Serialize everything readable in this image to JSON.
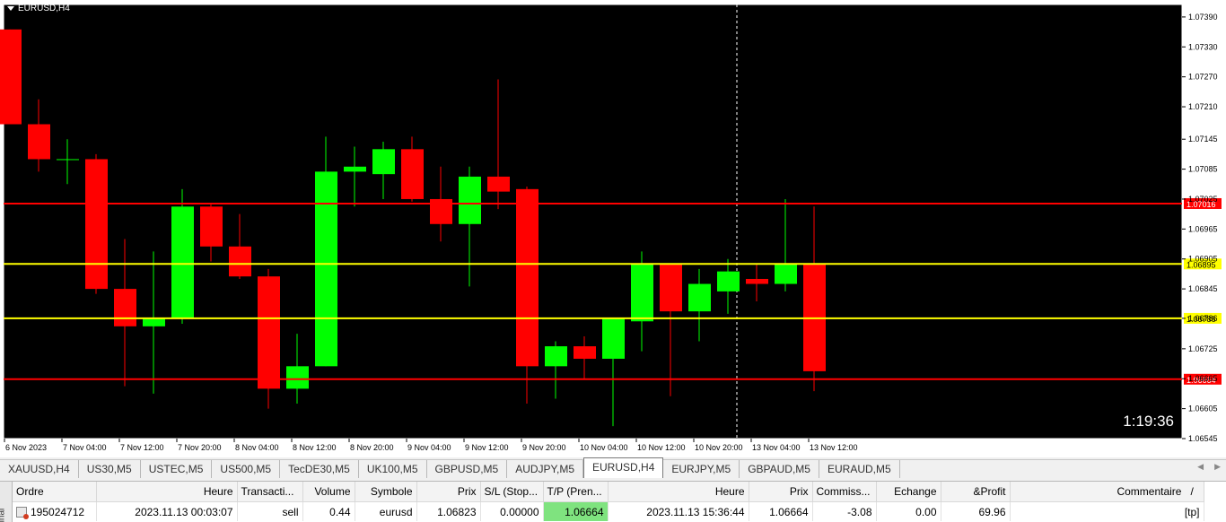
{
  "chart": {
    "title": "EURUSD,H4",
    "countdown": "1:19:36",
    "background": "#000000",
    "bull_color": "#00ff00",
    "bear_color": "#ff0000",
    "price_axis": [
      "1.07390",
      "1.07330",
      "1.07270",
      "1.07210",
      "1.07145",
      "1.07085",
      "1.07025",
      "1.06965",
      "1.06905",
      "1.06845",
      "1.06786",
      "1.06725",
      "1.06665",
      "1.06605",
      "1.06545"
    ],
    "price_min": 1.06545,
    "price_max": 1.07415,
    "time_axis": [
      "6 Nov 2023",
      "7 Nov 04:00",
      "7 Nov 12:00",
      "7 Nov 20:00",
      "8 Nov 04:00",
      "8 Nov 12:00",
      "8 Nov 20:00",
      "9 Nov 04:00",
      "9 Nov 12:00",
      "9 Nov 20:00",
      "10 Nov 04:00",
      "10 Nov 12:00",
      "10 Nov 20:00",
      "13 Nov 04:00",
      "13 Nov 12:00"
    ],
    "hlines": [
      {
        "price": 1.07016,
        "label": "1.07016",
        "color": "#ff0000",
        "text_color": "#ffffff"
      },
      {
        "price": 1.06895,
        "label": "1.06895",
        "color": "#ffff00",
        "text_color": "#000000"
      },
      {
        "price": 1.06786,
        "label": "1.06786",
        "color": "#ffff00",
        "text_color": "#000000"
      },
      {
        "price": 1.06664,
        "label": "1.06664",
        "color": "#ff0000",
        "text_color": "#ffffff"
      }
    ],
    "crosshair_x_index": 25,
    "candles": [
      {
        "o": 1.07365,
        "h": 1.07365,
        "l": 1.07175,
        "c": 1.07175
      },
      {
        "o": 1.07175,
        "h": 1.07225,
        "l": 1.0708,
        "c": 1.07105
      },
      {
        "o": 1.07105,
        "h": 1.07145,
        "l": 1.07055,
        "c": 1.07105
      },
      {
        "o": 1.07105,
        "h": 1.07115,
        "l": 1.06835,
        "c": 1.06845
      },
      {
        "o": 1.06845,
        "h": 1.06945,
        "l": 1.0665,
        "c": 1.0677
      },
      {
        "o": 1.0677,
        "h": 1.0692,
        "l": 1.06635,
        "c": 1.06785
      },
      {
        "o": 1.06785,
        "h": 1.07045,
        "l": 1.06775,
        "c": 1.0701
      },
      {
        "o": 1.0701,
        "h": 1.07015,
        "l": 1.069,
        "c": 1.0693
      },
      {
        "o": 1.0693,
        "h": 1.06995,
        "l": 1.06865,
        "c": 1.0687
      },
      {
        "o": 1.0687,
        "h": 1.06885,
        "l": 1.06605,
        "c": 1.06645
      },
      {
        "o": 1.06645,
        "h": 1.06755,
        "l": 1.06615,
        "c": 1.0669
      },
      {
        "o": 1.0669,
        "h": 1.0715,
        "l": 1.0669,
        "c": 1.0708
      },
      {
        "o": 1.0708,
        "h": 1.0713,
        "l": 1.0701,
        "c": 1.0709
      },
      {
        "o": 1.07075,
        "h": 1.0714,
        "l": 1.07025,
        "c": 1.07125
      },
      {
        "o": 1.07125,
        "h": 1.0715,
        "l": 1.0702,
        "c": 1.07025
      },
      {
        "o": 1.07025,
        "h": 1.0709,
        "l": 1.0694,
        "c": 1.06975
      },
      {
        "o": 1.06975,
        "h": 1.0709,
        "l": 1.0685,
        "c": 1.0707
      },
      {
        "o": 1.0707,
        "h": 1.07265,
        "l": 1.07005,
        "c": 1.0704
      },
      {
        "o": 1.07045,
        "h": 1.0705,
        "l": 1.06615,
        "c": 1.0669
      },
      {
        "o": 1.0669,
        "h": 1.0674,
        "l": 1.06625,
        "c": 1.0673
      },
      {
        "o": 1.0673,
        "h": 1.0675,
        "l": 1.06665,
        "c": 1.06705
      },
      {
        "o": 1.06705,
        "h": 1.0678,
        "l": 1.0657,
        "c": 1.06785
      },
      {
        "o": 1.0678,
        "h": 1.0692,
        "l": 1.0672,
        "c": 1.06895
      },
      {
        "o": 1.06895,
        "h": 1.06895,
        "l": 1.0663,
        "c": 1.068
      },
      {
        "o": 1.068,
        "h": 1.06885,
        "l": 1.0674,
        "c": 1.06855
      },
      {
        "o": 1.0684,
        "h": 1.06905,
        "l": 1.06795,
        "c": 1.0688
      },
      {
        "o": 1.06865,
        "h": 1.06895,
        "l": 1.0682,
        "c": 1.06855
      },
      {
        "o": 1.06855,
        "h": 1.07025,
        "l": 1.0684,
        "c": 1.06895
      },
      {
        "o": 1.06895,
        "h": 1.0701,
        "l": 1.0664,
        "c": 1.0668
      }
    ]
  },
  "tabs": {
    "items": [
      "XAUUSD,H4",
      "US30,M5",
      "USTEC,M5",
      "US500,M5",
      "TecDE30,M5",
      "UK100,M5",
      "GBPUSD,M5",
      "AUDJPY,M5",
      "EURUSD,H4",
      "EURJPY,M5",
      "GBPAUD,M5",
      "EURAUD,M5"
    ],
    "active": "EURUSD,H4"
  },
  "terminal": {
    "side_label": "inal",
    "columns": [
      "Ordre",
      "Heure",
      "Transacti...",
      "Volume",
      "Symbole",
      "Prix",
      "S/L (Stop...",
      "T/P (Pren...",
      "Heure",
      "Prix",
      "Commiss...",
      "Echange",
      "&Profit",
      "Commentaire"
    ],
    "sort_indicator": "/",
    "row": {
      "ordre": "195024712",
      "heure_open": "2023.11.13 00:03:07",
      "transaction": "sell",
      "volume": "0.44",
      "symbole": "eurusd",
      "prix_open": "1.06823",
      "sl": "0.00000",
      "tp": "1.06664",
      "heure_close": "2023.11.13 15:36:44",
      "prix_close": "1.06664",
      "commission": "-3.08",
      "echange": "0.00",
      "profit": "69.96",
      "commentaire": "[tp]"
    }
  }
}
